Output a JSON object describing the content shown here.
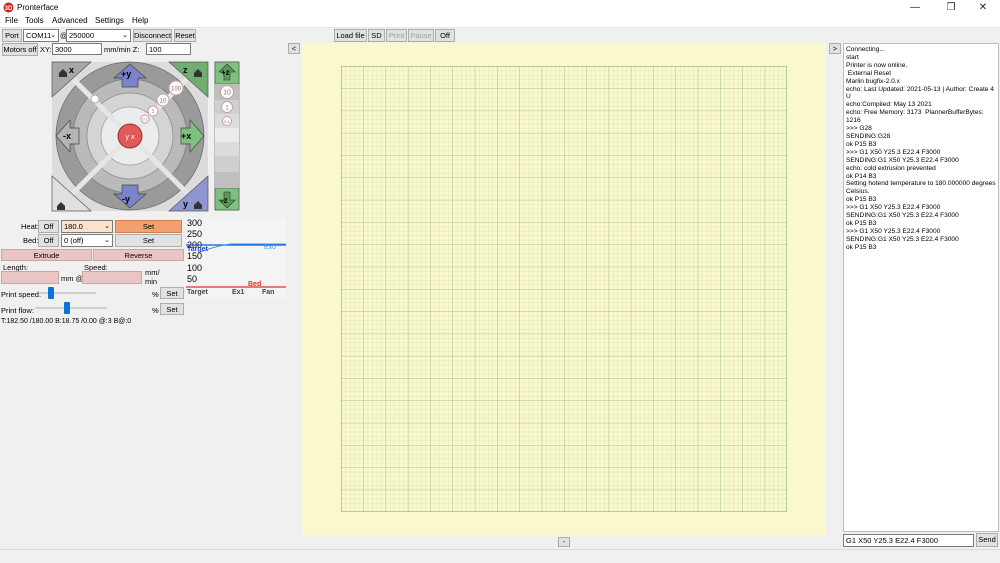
{
  "app": {
    "title": "Pronterface",
    "window_controls": {
      "minimize": "—",
      "maximize": "❐",
      "close": "✕"
    }
  },
  "menu": [
    "File",
    "Tools",
    "Advanced",
    "Settings",
    "Help"
  ],
  "toolbar": {
    "port_label": "Port",
    "port_value": "COM11",
    "at": "@",
    "baud_value": "250000",
    "disconnect": "Disconnect",
    "reset": "Reset",
    "motors_off": "Motors off",
    "xy_label": "XY:",
    "xy_speed": "3000",
    "mm_min_z": "mm/min Z:",
    "z_speed": "100"
  },
  "center_toolbar": {
    "collapse_left": "<",
    "load_file": "Load file",
    "sd": "SD",
    "print": "Print",
    "pause": "Pause",
    "off": "Off",
    "collapse_right": ">",
    "collapse_bottom": "-"
  },
  "jog": {
    "plus_y": "+y",
    "minus_y": "-y",
    "plus_x": "+x",
    "minus_x": "-x",
    "home_x": "x",
    "home_y": "y",
    "home_z": "z",
    "steps": [
      "100",
      "10",
      "1",
      "0.1"
    ],
    "z_plus": "+z",
    "z_minus": "-z",
    "z_steps": [
      "10",
      "1",
      "0.1"
    ]
  },
  "temps": {
    "heat_label": "Heat:",
    "heat_off": "Off",
    "heat_value": "180.0",
    "heat_set": "Set",
    "bed_label": "Bed:",
    "bed_off": "Off",
    "bed_value": "0 (off)",
    "bed_set": "Set"
  },
  "extrude": {
    "extrude": "Extrude",
    "reverse": "Reverse",
    "length_label": "Length:",
    "speed_label": "Speed:",
    "mm_at": "mm @",
    "mm_min": "mm/\nmin",
    "print_speed_label": "Print speed:",
    "print_flow_label": "Print flow:",
    "percent": "%",
    "set": "Set",
    "print_speed_level": 0.2,
    "print_flow_level": 0.45
  },
  "status_line": "T:182.50 /180.00 B:18.75 /0.00 @:3 B@:0",
  "temp_graph": {
    "ticks": [
      "300",
      "250",
      "200",
      "150",
      "100",
      "50"
    ],
    "labels": {
      "target": "Target",
      "ex0": "Ex0",
      "bed": "Bed",
      "ex1": "Ex1",
      "fan": "Fan"
    },
    "colors": {
      "target": "#1f4fd0",
      "ex0": "#2a9df4",
      "bed": "#e03030"
    }
  },
  "log": [
    "Connecting...",
    "start",
    "Printer is now online.",
    " External Reset",
    "Marlin bugfix-2.0.x",
    "echo: Last Updated: 2021-05-13 | Author: Create 4 U",
    "echo:Compiled: May 13 2021",
    "echo: Free Memory: 3173  PlannerBufferBytes: 1216",
    ">>> G28",
    "SENDING:G28",
    "ok P15 B3",
    ">>> G1 X50 Y25.3 E22.4 F3000",
    "SENDING:G1 X50 Y25.3 E22.4 F3000",
    "echo: cold extrusion prevented",
    "ok P14 B3",
    "Setting hotend temperature to 180.000000 degrees Celsius.",
    "ok P15 B3",
    ">>> G1 X50 Y25.3 E22.4 F3000",
    "SENDING:G1 X50 Y25.3 E22.4 F3000",
    "ok P15 B3",
    ">>> G1 X50 Y25.3 E22.4 F3000",
    "SENDING:G1 X50 Y25.3 E22.4 F3000",
    "ok P15 B3"
  ],
  "command": {
    "value": "G1 X50 Y25.3 E22.4 F3000",
    "send": "Send"
  },
  "colors": {
    "plate": "#f9f9cd",
    "grid_major": "#97b387",
    "grid_minor": "#c8d8a8",
    "heat_accent": "#f4a070",
    "extrude_btn": "#e9c5c5"
  }
}
